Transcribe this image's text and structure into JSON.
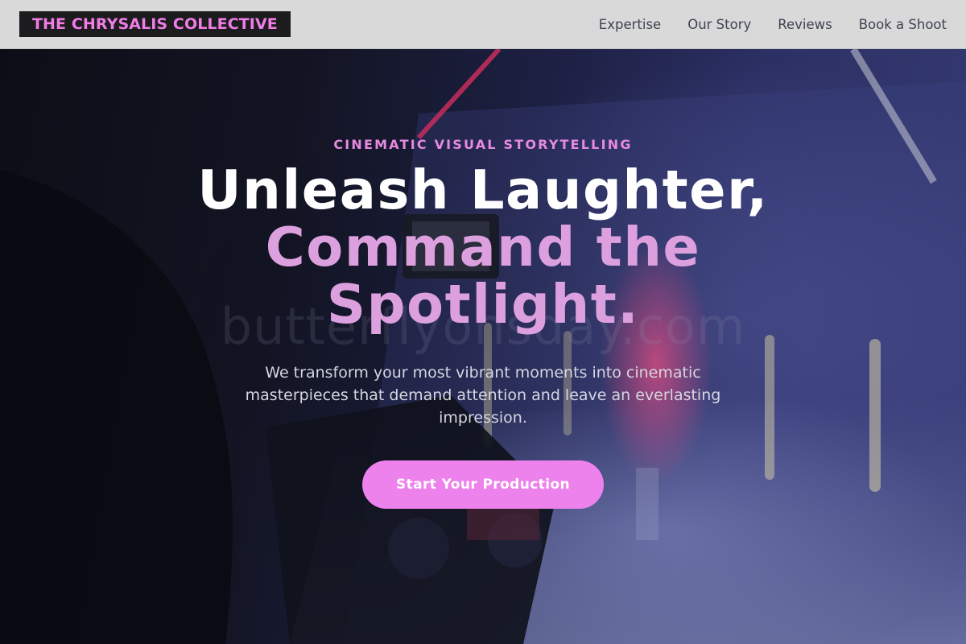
{
  "header": {
    "logo_text": "THE CHRYSALIS COLLECTIVE",
    "nav": [
      {
        "label": "Expertise"
      },
      {
        "label": "Our Story"
      },
      {
        "label": "Reviews"
      },
      {
        "label": "Book a Shoot"
      }
    ]
  },
  "hero": {
    "eyebrow": "CINEMATIC VISUAL STORYTELLING",
    "headline_line1": "Unleash Laughter,",
    "headline_line2": "Command the",
    "headline_line3": "Spotlight.",
    "watermark": "butterflyonsday.com",
    "subcopy": "We transform your most vibrant moments into cinematic masterpieces that demand attention and leave an everlasting impression.",
    "cta_label": "Start Your Production"
  },
  "colors": {
    "accent_pink": "#ee82ec",
    "logo_pink": "#f07ce6",
    "headline_pink": "#dca0de",
    "header_bg": "#d9d9d9",
    "logo_bg": "#1c1c1e"
  }
}
